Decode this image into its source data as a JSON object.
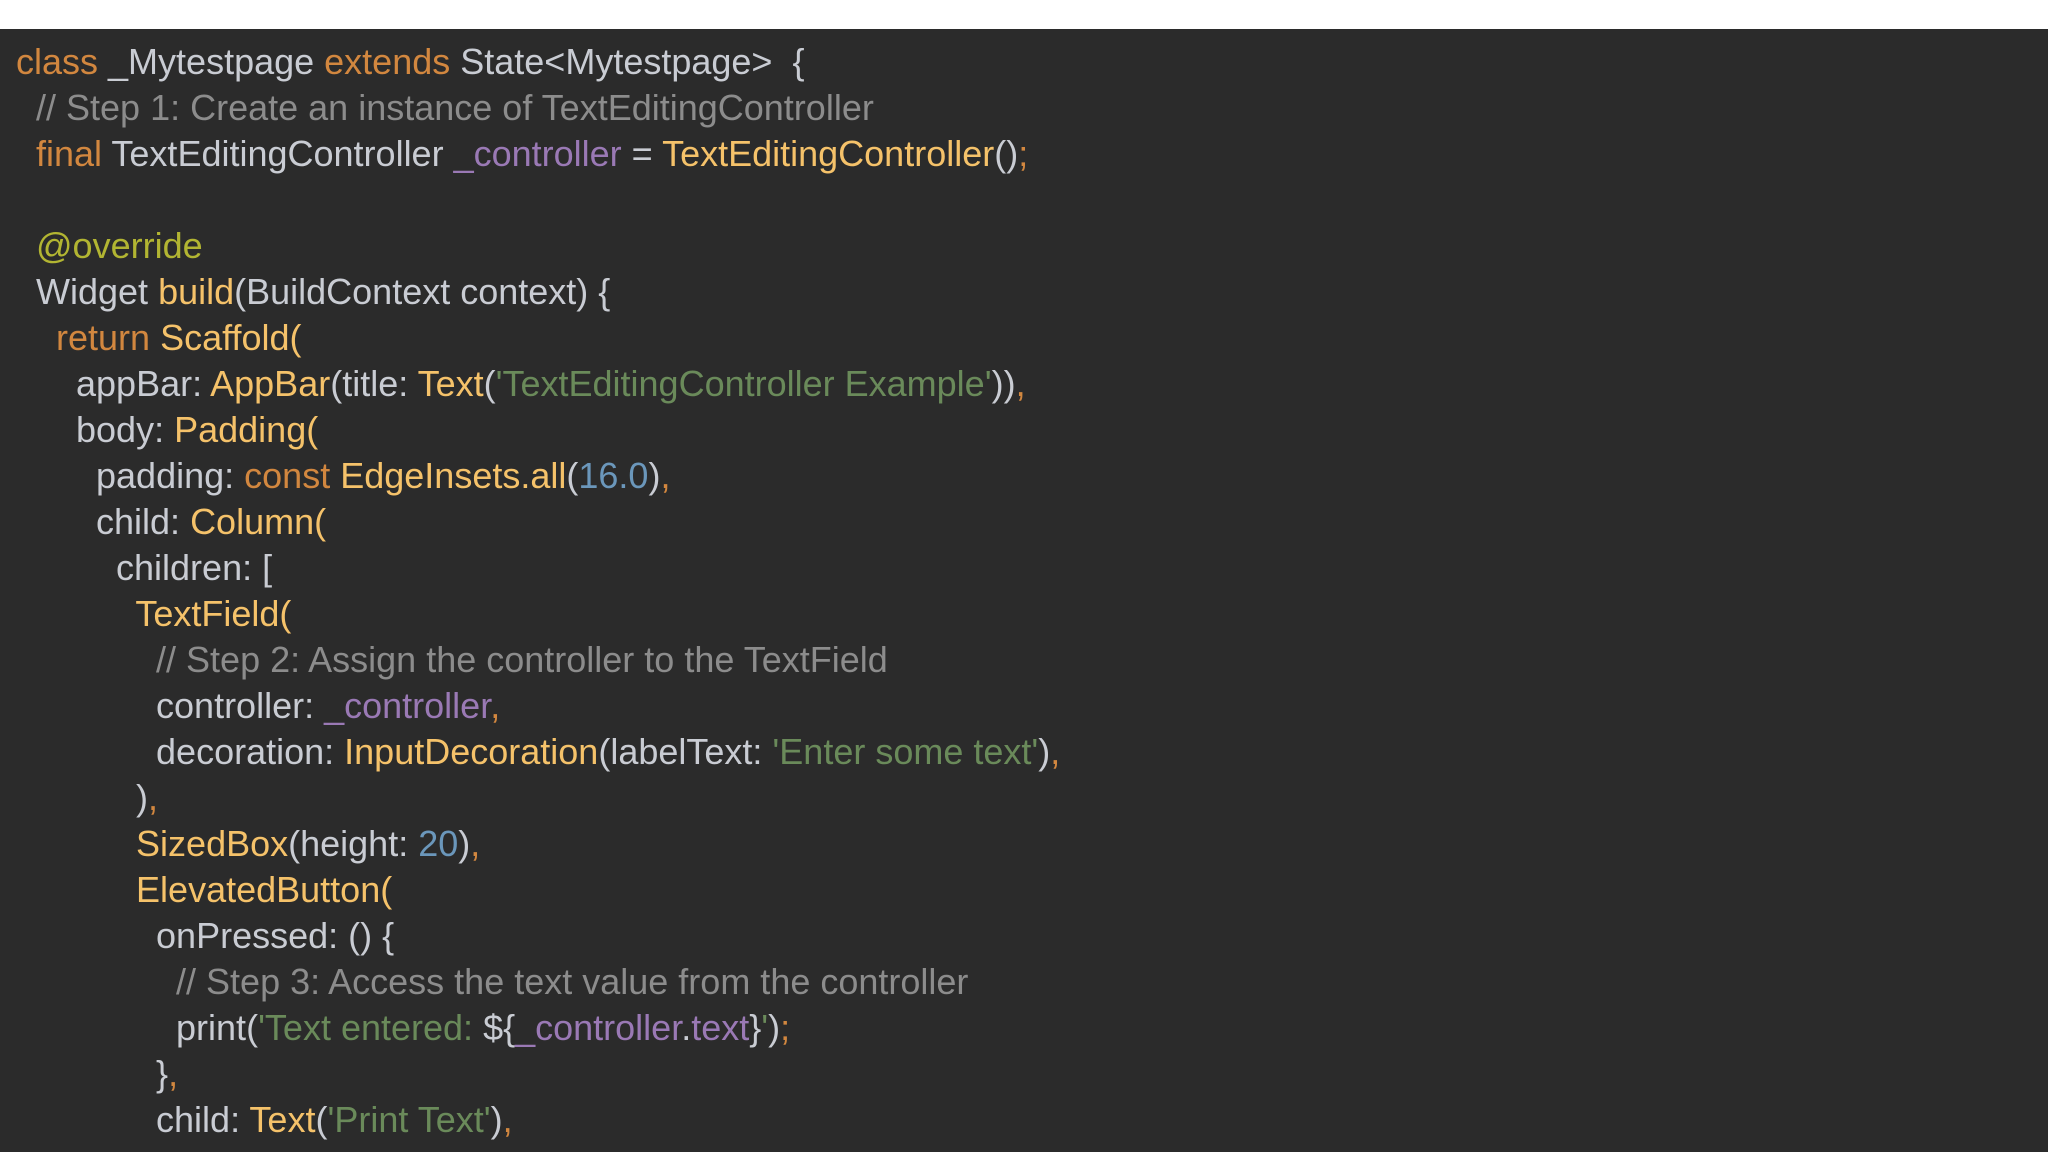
{
  "editor": {
    "colors": {
      "background": "#2b2b2b",
      "plain": "#c9ccd3",
      "keyword": "#d2873f",
      "comment": "#8c8c8c",
      "field": "#9a79b5",
      "function": "#f5c26a",
      "string": "#6a8a5a",
      "number": "#6b97bb",
      "annotation": "#b2b532"
    },
    "lines": [
      [
        [
          "keyword",
          "class"
        ],
        [
          "plain",
          " _Mytestpage "
        ],
        [
          "keyword",
          "extends"
        ],
        [
          "plain",
          " State<Mytestpage>  {"
        ]
      ],
      [
        [
          "plain",
          "  "
        ],
        [
          "comment",
          "// Step 1: Create an instance of TextEditingController"
        ]
      ],
      [
        [
          "plain",
          "  "
        ],
        [
          "keyword",
          "final"
        ],
        [
          "plain",
          " TextEditingController "
        ],
        [
          "field",
          "_controller"
        ],
        [
          "plain",
          " = "
        ],
        [
          "func",
          "TextEditingController"
        ],
        [
          "plain",
          "()"
        ],
        [
          "punct",
          ";"
        ]
      ],
      [],
      [
        [
          "plain",
          "  "
        ],
        [
          "annot",
          "@override"
        ]
      ],
      [
        [
          "plain",
          "  Widget "
        ],
        [
          "func",
          "build"
        ],
        [
          "plain",
          "(BuildContext context) {"
        ]
      ],
      [
        [
          "plain",
          "    "
        ],
        [
          "keyword",
          "return"
        ],
        [
          "plain",
          " "
        ],
        [
          "func",
          "Scaffold("
        ]
      ],
      [
        [
          "plain",
          "      appBar: "
        ],
        [
          "func",
          "AppBar"
        ],
        [
          "plain",
          "(title: "
        ],
        [
          "func",
          "Text"
        ],
        [
          "plain",
          "("
        ],
        [
          "string",
          "'TextEditingController Example'"
        ],
        [
          "plain",
          "))"
        ],
        [
          "punct",
          ","
        ]
      ],
      [
        [
          "plain",
          "      body: "
        ],
        [
          "func",
          "Padding("
        ]
      ],
      [
        [
          "plain",
          "        padding: "
        ],
        [
          "keyword",
          "const"
        ],
        [
          "plain",
          " "
        ],
        [
          "func",
          "EdgeInsets.all"
        ],
        [
          "plain",
          "("
        ],
        [
          "number",
          "16.0"
        ],
        [
          "plain",
          ")"
        ],
        [
          "punct",
          ","
        ]
      ],
      [
        [
          "plain",
          "        child: "
        ],
        [
          "func",
          "Column("
        ]
      ],
      [
        [
          "plain",
          "          children: ["
        ]
      ],
      [
        [
          "plain",
          "            "
        ],
        [
          "func",
          "TextField("
        ]
      ],
      [
        [
          "plain",
          "              "
        ],
        [
          "comment",
          "// Step 2: Assign the controller to the TextField"
        ]
      ],
      [
        [
          "plain",
          "              controller: "
        ],
        [
          "field",
          "_controller"
        ],
        [
          "punct",
          ","
        ]
      ],
      [
        [
          "plain",
          "              decoration: "
        ],
        [
          "func",
          "InputDecoration"
        ],
        [
          "plain",
          "(labelText: "
        ],
        [
          "string",
          "'Enter some text'"
        ],
        [
          "plain",
          ")"
        ],
        [
          "punct",
          ","
        ]
      ],
      [
        [
          "plain",
          "            )"
        ],
        [
          "punct",
          ","
        ]
      ],
      [
        [
          "plain",
          "            "
        ],
        [
          "func",
          "SizedBox"
        ],
        [
          "plain",
          "(height: "
        ],
        [
          "number",
          "20"
        ],
        [
          "plain",
          ")"
        ],
        [
          "punct",
          ","
        ]
      ],
      [
        [
          "plain",
          "            "
        ],
        [
          "func",
          "ElevatedButton("
        ]
      ],
      [
        [
          "plain",
          "              onPressed: () {"
        ]
      ],
      [
        [
          "plain",
          "                "
        ],
        [
          "comment",
          "// Step 3: Access the text value from the controller"
        ]
      ],
      [
        [
          "plain",
          "                print("
        ],
        [
          "string",
          "'Text entered: "
        ],
        [
          "plain",
          "${"
        ],
        [
          "field",
          "_controller"
        ],
        [
          "plain",
          "."
        ],
        [
          "field",
          "text"
        ],
        [
          "plain",
          "}"
        ],
        [
          "string",
          "'"
        ],
        [
          "plain",
          ")"
        ],
        [
          "punct",
          ";"
        ]
      ],
      [
        [
          "plain",
          "              }"
        ],
        [
          "punct",
          ","
        ]
      ],
      [
        [
          "plain",
          "              child: "
        ],
        [
          "func",
          "Text"
        ],
        [
          "plain",
          "("
        ],
        [
          "string",
          "'Print Text'"
        ],
        [
          "plain",
          ")"
        ],
        [
          "punct",
          ","
        ]
      ]
    ]
  }
}
